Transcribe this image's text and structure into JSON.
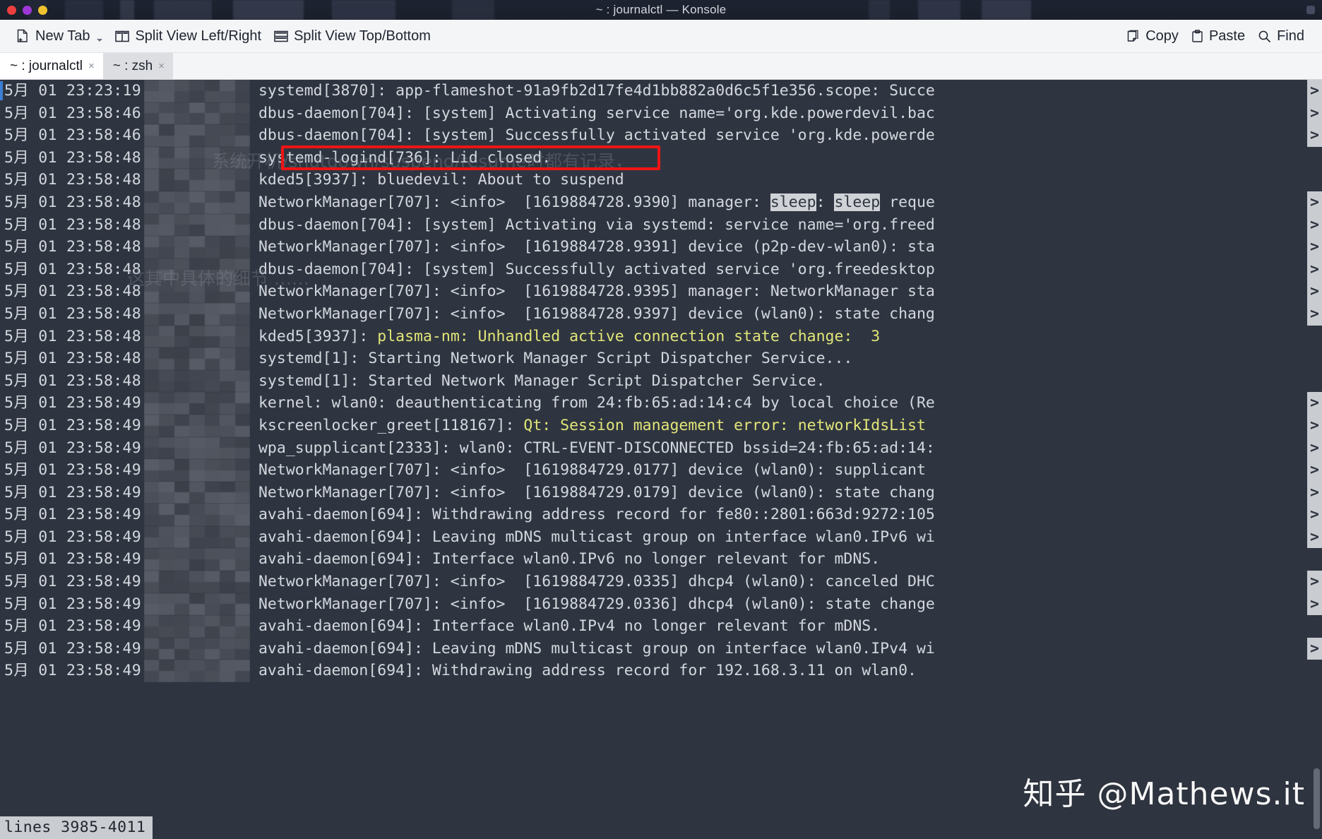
{
  "window": {
    "title": "~ : journalctl — Konsole",
    "controls": [
      "close",
      "minimize",
      "maximize"
    ]
  },
  "toolbar": {
    "new_tab": "New Tab",
    "split_left_right": "Split View Left/Right",
    "split_top_bottom": "Split View Top/Bottom",
    "copy": "Copy",
    "paste": "Paste",
    "find": "Find"
  },
  "tabs": [
    {
      "label": "~ : journalctl",
      "close": "×",
      "active": true
    },
    {
      "label": "~ : zsh",
      "close": "×",
      "active": false
    }
  ],
  "terminal": {
    "status_line": "lines 3985-4011",
    "continuation_marker": ">",
    "colors": {
      "background": "#2f3540",
      "foreground": "#d3d7de",
      "yellow": "#e2e678",
      "selection_bg": "#cfd2d6",
      "status_bg": "#c9ccd1",
      "highlight_box": "#f01414",
      "cursor": "#3c7fd4"
    },
    "lines": [
      {
        "date": "5月 01 23:23:19",
        "msg": "systemd[3870]: app-flameshot-91a9fb2d17fe4d1bb882a0d6c5f1e356.scope: Succe",
        "cont": true
      },
      {
        "date": "5月 01 23:58:46",
        "msg": "dbus-daemon[704]: [system] Activating service name='org.kde.powerdevil.bac",
        "cont": true
      },
      {
        "date": "5月 01 23:58:46",
        "msg": "dbus-daemon[704]: [system] Successfully activated service 'org.kde.powerde",
        "cont": true
      },
      {
        "date": "5月 01 23:58:48",
        "msg": "systemd-logind[736]: Lid closed.",
        "cont": false,
        "boxed": true
      },
      {
        "date": "5月 01 23:58:48",
        "msg": "kded5[3937]: bluedevil: About to suspend",
        "cont": false
      },
      {
        "date": "5月 01 23:58:48",
        "msg": "NetworkManager[707]: <info>  [1619884728.9390] manager: sleep: sleep reque",
        "cont": true,
        "inverts": [
          "sleep",
          "sleep"
        ]
      },
      {
        "date": "5月 01 23:58:48",
        "msg": "dbus-daemon[704]: [system] Activating via systemd: service name='org.freed",
        "cont": true
      },
      {
        "date": "5月 01 23:58:48",
        "msg": "NetworkManager[707]: <info>  [1619884728.9391] device (p2p-dev-wlan0): sta",
        "cont": true
      },
      {
        "date": "5月 01 23:58:48",
        "msg": "dbus-daemon[704]: [system] Successfully activated service 'org.freedesktop",
        "cont": true
      },
      {
        "date": "5月 01 23:58:48",
        "msg": "NetworkManager[707]: <info>  [1619884728.9395] manager: NetworkManager sta",
        "cont": true
      },
      {
        "date": "5月 01 23:58:48",
        "msg": "NetworkManager[707]: <info>  [1619884728.9397] device (wlan0): state chang",
        "cont": true
      },
      {
        "date": "5月 01 23:58:48",
        "msg": "kded5[3937]: plasma-nm: Unhandled active connection state change:  3",
        "cont": false,
        "yellow_from": 13
      },
      {
        "date": "5月 01 23:58:48",
        "msg": "systemd[1]: Starting Network Manager Script Dispatcher Service...",
        "cont": false
      },
      {
        "date": "5月 01 23:58:48",
        "msg": "systemd[1]: Started Network Manager Script Dispatcher Service.",
        "cont": false
      },
      {
        "date": "5月 01 23:58:49",
        "msg": "kernel: wlan0: deauthenticating from 24:fb:65:ad:14:c4 by local choice (Re",
        "cont": true
      },
      {
        "date": "5月 01 23:58:49",
        "msg": "kscreenlocker_greet[118167]: Qt: Session management error: networkIdsList",
        "cont": true,
        "yellow_from": 29
      },
      {
        "date": "5月 01 23:58:49",
        "msg": "wpa_supplicant[2333]: wlan0: CTRL-EVENT-DISCONNECTED bssid=24:fb:65:ad:14:",
        "cont": true
      },
      {
        "date": "5月 01 23:58:49",
        "msg": "NetworkManager[707]: <info>  [1619884729.0177] device (wlan0): supplicant ",
        "cont": true
      },
      {
        "date": "5月 01 23:58:49",
        "msg": "NetworkManager[707]: <info>  [1619884729.0179] device (wlan0): state chang",
        "cont": true
      },
      {
        "date": "5月 01 23:58:49",
        "msg": "avahi-daemon[694]: Withdrawing address record for fe80::2801:663d:9272:105",
        "cont": true
      },
      {
        "date": "5月 01 23:58:49",
        "msg": "avahi-daemon[694]: Leaving mDNS multicast group on interface wlan0.IPv6 wi",
        "cont": true
      },
      {
        "date": "5月 01 23:58:49",
        "msg": "avahi-daemon[694]: Interface wlan0.IPv6 no longer relevant for mDNS.",
        "cont": false
      },
      {
        "date": "5月 01 23:58:49",
        "msg": "NetworkManager[707]: <info>  [1619884729.0335] dhcp4 (wlan0): canceled DHC",
        "cont": true
      },
      {
        "date": "5月 01 23:58:49",
        "msg": "NetworkManager[707]: <info>  [1619884729.0336] dhcp4 (wlan0): state change",
        "cont": true
      },
      {
        "date": "5月 01 23:58:49",
        "msg": "avahi-daemon[694]: Interface wlan0.IPv4 no longer relevant for mDNS.",
        "cont": false
      },
      {
        "date": "5月 01 23:58:49",
        "msg": "avahi-daemon[694]: Leaving mDNS multicast group on interface wlan0.IPv4 wi",
        "cont": true
      },
      {
        "date": "5月 01 23:58:49",
        "msg": "avahi-daemon[694]: Withdrawing address record for 192.168.3.11 on wlan0.",
        "cont": false
      }
    ]
  },
  "watermarks": {
    "main": "知乎 @Mathews.it",
    "ghost_1": "系统开机/shutdown/suspend/resume时都有记录，",
    "ghost_2": "这其中具体的细节 ……"
  }
}
